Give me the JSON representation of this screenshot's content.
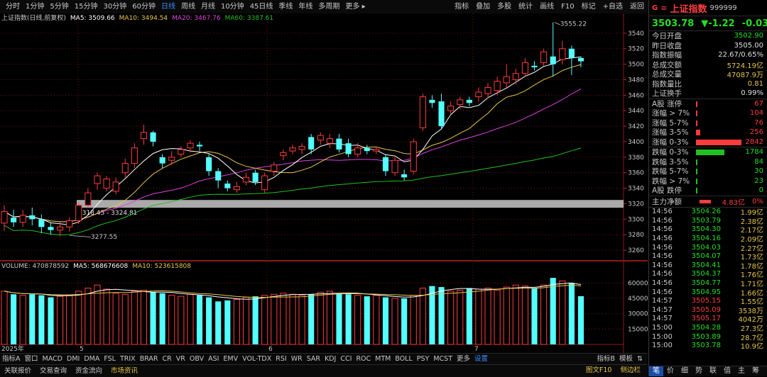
{
  "topbar": {
    "periods": [
      "分时",
      "1分钟",
      "5分钟",
      "15分钟",
      "30分钟",
      "60分钟",
      "日线",
      "周线",
      "月线",
      "10分钟",
      "45日线",
      "季线",
      "年线",
      "多周期",
      "更多 ▸"
    ],
    "active_index": 6,
    "tools": [
      "指标",
      "叠加",
      "多股",
      "统计",
      "画线",
      "F10",
      "标记",
      "+自选",
      "返回"
    ]
  },
  "legend": {
    "title": "上证指数(日线,前复权)",
    "ma5": "MA5: 3509.66",
    "ma10": "MA10: 3494.54",
    "ma20": "MA20: 3467.76",
    "ma60": "MA60: 3387.61"
  },
  "annotations": {
    "high": "3555.22",
    "low": "3277.55",
    "range_box": "3318.45 - 3324.81"
  },
  "volume_legend": {
    "volume": "VOLUME: 470878592",
    "ma5": "MA5: 568676608",
    "ma10": "MA10: 523615808"
  },
  "colors": {
    "up": "#ff3c3c",
    "down": "#54ffff",
    "ma5": "#ffffff",
    "ma10": "#e6c64a",
    "ma20": "#e040e0",
    "ma60": "#20c020",
    "grid": "#8b1a1a"
  },
  "chart_data": {
    "type": "candlestick",
    "price_axis": {
      "ticks": [
        3260,
        3280,
        3300,
        3320,
        3340,
        3360,
        3380,
        3400,
        3420,
        3440,
        3460,
        3480,
        3500,
        3520,
        3540
      ],
      "range": [
        3250,
        3560
      ]
    },
    "volume_axis": {
      "ticks": [
        "60000",
        "45000",
        "30000",
        "15000"
      ],
      "range": [
        0,
        72000
      ]
    },
    "x_labels": [
      "2025年",
      "5",
      "6",
      "7"
    ],
    "candles": [
      [
        3295,
        3310,
        3285,
        3318
      ],
      [
        3302,
        3296,
        3290,
        3312
      ],
      [
        3296,
        3305,
        3290,
        3312
      ],
      [
        3305,
        3300,
        3292,
        3315
      ],
      [
        3300,
        3290,
        3282,
        3306
      ],
      [
        3290,
        3286,
        3280,
        3296
      ],
      [
        3286,
        3290,
        3278,
        3296
      ],
      [
        3290,
        3298,
        3284,
        3302
      ],
      [
        3298,
        3318,
        3294,
        3322
      ],
      [
        3318,
        3334,
        3314,
        3340
      ],
      [
        3346,
        3356,
        3338,
        3360
      ],
      [
        3340,
        3352,
        3336,
        3356
      ],
      [
        3336,
        3348,
        3332,
        3354
      ],
      [
        3360,
        3372,
        3354,
        3378
      ],
      [
        3372,
        3392,
        3366,
        3398
      ],
      [
        3404,
        3412,
        3396,
        3422
      ],
      [
        3412,
        3400,
        3394,
        3414
      ],
      [
        3380,
        3372,
        3366,
        3384
      ],
      [
        3376,
        3380,
        3370,
        3388
      ],
      [
        3384,
        3390,
        3380,
        3394
      ],
      [
        3392,
        3398,
        3386,
        3402
      ],
      [
        3396,
        3394,
        3388,
        3400
      ],
      [
        3380,
        3362,
        3356,
        3384
      ],
      [
        3362,
        3350,
        3340,
        3366
      ],
      [
        3346,
        3340,
        3336,
        3350
      ],
      [
        3338,
        3342,
        3334,
        3348
      ],
      [
        3348,
        3354,
        3344,
        3360
      ],
      [
        3360,
        3348,
        3344,
        3364
      ],
      [
        3338,
        3356,
        3334,
        3360
      ],
      [
        3362,
        3370,
        3356,
        3374
      ],
      [
        3382,
        3386,
        3376,
        3390
      ],
      [
        3388,
        3392,
        3384,
        3396
      ],
      [
        3390,
        3394,
        3384,
        3398
      ],
      [
        3406,
        3390,
        3384,
        3410
      ],
      [
        3402,
        3408,
        3396,
        3412
      ],
      [
        3398,
        3404,
        3392,
        3410
      ],
      [
        3404,
        3390,
        3386,
        3410
      ],
      [
        3398,
        3384,
        3380,
        3404
      ],
      [
        3384,
        3392,
        3380,
        3398
      ],
      [
        3392,
        3388,
        3384,
        3396
      ],
      [
        3388,
        3390,
        3384,
        3394
      ],
      [
        3380,
        3362,
        3356,
        3384
      ],
      [
        3360,
        3376,
        3356,
        3380
      ],
      [
        3358,
        3354,
        3350,
        3364
      ],
      [
        3362,
        3400,
        3358,
        3404
      ],
      [
        3418,
        3458,
        3414,
        3462
      ],
      [
        3454,
        3450,
        3444,
        3460
      ],
      [
        3452,
        3420,
        3416,
        3462
      ],
      [
        3440,
        3446,
        3436,
        3452
      ],
      [
        3448,
        3454,
        3442,
        3458
      ],
      [
        3454,
        3450,
        3446,
        3458
      ],
      [
        3458,
        3464,
        3452,
        3470
      ],
      [
        3462,
        3470,
        3456,
        3476
      ],
      [
        3466,
        3478,
        3460,
        3484
      ],
      [
        3476,
        3484,
        3470,
        3500
      ],
      [
        3480,
        3488,
        3474,
        3494
      ],
      [
        3488,
        3502,
        3484,
        3508
      ],
      [
        3498,
        3496,
        3492,
        3504
      ],
      [
        3502,
        3516,
        3498,
        3520
      ],
      [
        3510,
        3500,
        3484,
        3554
      ],
      [
        3506,
        3520,
        3500,
        3530
      ],
      [
        3520,
        3508,
        3486,
        3524
      ],
      [
        3508,
        3503.78,
        3496,
        3510
      ]
    ],
    "volumes": [
      52000,
      49000,
      48000,
      49000,
      48000,
      46000,
      47000,
      48000,
      52000,
      55000,
      58000,
      54000,
      50000,
      49000,
      52000,
      53000,
      51000,
      50000,
      48000,
      47000,
      49000,
      48000,
      46000,
      42000,
      43000,
      44000,
      46000,
      47000,
      48000,
      49000,
      50000,
      49000,
      48000,
      49000,
      51000,
      52000,
      50000,
      49000,
      48000,
      47000,
      48000,
      46000,
      45000,
      45000,
      48000,
      55000,
      57000,
      56000,
      52000,
      53000,
      55000,
      54000,
      55000,
      53000,
      56000,
      58000,
      57000,
      55000,
      58000,
      65000,
      62000,
      60000,
      47087
    ]
  },
  "indicators": {
    "label": "指标A",
    "items": [
      "窗口",
      "MACD",
      "DMI",
      "DMA",
      "FSL",
      "TRIX",
      "BRAR",
      "CR",
      "VR",
      "OBV",
      "ASI",
      "EMV",
      "VOL-TDX",
      "RSI",
      "WR",
      "SAR",
      "KDJ",
      "CCI",
      "ROC",
      "MTM",
      "BOLL",
      "PSY",
      "MCST",
      "更多",
      "设置"
    ],
    "right": [
      "指标B",
      "模板",
      "⇅"
    ]
  },
  "footer": {
    "items": [
      "关联报价",
      "交易查询",
      "资金流向",
      "市场资讯"
    ],
    "active_index": 3,
    "right": [
      "图文F10",
      "侧边栏"
    ]
  },
  "panel": {
    "g": "G",
    "menu": "≡",
    "name": "上证指数",
    "code": "999999",
    "price": "3503.78",
    "change": "▼-1.22",
    "pct": "-0.03%",
    "stats": [
      {
        "label": "今日开盘",
        "value": "3502.90",
        "color": "green"
      },
      {
        "label": "昨日收盘",
        "value": "3505.00",
        "color": "white"
      },
      {
        "label": "指数振幅",
        "value": "22.67/0.65%",
        "color": "white"
      },
      {
        "label": "总成交额",
        "value": "5724.19亿",
        "color": "yellow"
      },
      {
        "label": "总成交量",
        "value": "47087.9万",
        "color": "yellow"
      },
      {
        "label": "指数量比",
        "value": "0.81",
        "color": "yellow"
      },
      {
        "label": "上证换手",
        "value": "0.99%",
        "color": "white"
      }
    ],
    "breadth_up": [
      {
        "label": "A股 涨停",
        "value": "67",
        "bar": 0.0
      },
      {
        "label": "涨幅 > 7%",
        "value": "104",
        "bar": 0.0
      },
      {
        "label": "涨幅 5-7%",
        "value": "76",
        "bar": 0.0
      },
      {
        "label": "涨幅 3-5%",
        "value": "256",
        "bar": 0.09
      },
      {
        "label": "涨幅 0-3%",
        "value": "2842",
        "bar": 1.0
      }
    ],
    "breadth_down": [
      {
        "label": "跌幅 0-3%",
        "value": "1784",
        "bar": 0.63
      },
      {
        "label": "跌幅 3-5%",
        "value": "84",
        "bar": 0.0
      },
      {
        "label": "跌幅 5-7%",
        "value": "30",
        "bar": 0.0
      },
      {
        "label": "跌幅 > 7%",
        "value": "23",
        "bar": 0.0
      },
      {
        "label": "A股 跌停",
        "value": "0",
        "bar": 0.0
      }
    ],
    "flow": {
      "label": "主力净额",
      "value": "4.83亿",
      "pct": "0%"
    },
    "ticks": [
      {
        "time": "14:56",
        "price": "3504.26",
        "vol": "1.99亿",
        "pc": "green",
        "vc": "yellow"
      },
      {
        "time": "14:56",
        "price": "3503.79",
        "vol": "2.38亿",
        "pc": "green",
        "vc": "yellow"
      },
      {
        "time": "14:56",
        "price": "3504.30",
        "vol": "2.17亿",
        "pc": "green",
        "vc": "yellow"
      },
      {
        "time": "14:56",
        "price": "3504.16",
        "vol": "2.09亿",
        "pc": "green",
        "vc": "yellow"
      },
      {
        "time": "14:56",
        "price": "3504.03",
        "vol": "2.27亿",
        "pc": "green",
        "vc": "yellow"
      },
      {
        "time": "14:56",
        "price": "3504.07",
        "vol": "1.73亿",
        "pc": "green",
        "vc": "yellow"
      },
      {
        "time": "14:56",
        "price": "3504.41",
        "vol": "1.78亿",
        "pc": "green",
        "vc": "yellow"
      },
      {
        "time": "14:56",
        "price": "3504.37",
        "vol": "1.76亿",
        "pc": "green",
        "vc": "yellow"
      },
      {
        "time": "14:56",
        "price": "3504.77",
        "vol": "1.71亿",
        "pc": "green",
        "vc": "yellow"
      },
      {
        "time": "14:56",
        "price": "3504.95",
        "vol": "1.66亿",
        "pc": "green",
        "vc": "yellow"
      },
      {
        "time": "14:57",
        "price": "3505.15",
        "vol": "1.55亿",
        "pc": "red",
        "vc": "yellow"
      },
      {
        "time": "14:57",
        "price": "3505.09",
        "vol": "3538万",
        "pc": "red",
        "vc": "yellow"
      },
      {
        "time": "14:57",
        "price": "3505.17",
        "vol": "4042万",
        "pc": "red",
        "vc": "yellow"
      },
      {
        "time": "15:00",
        "price": "3504.28",
        "vol": "27.3亿",
        "pc": "green",
        "vc": "yellow"
      },
      {
        "time": "15:00",
        "price": "3503.89",
        "vol": "28.7亿",
        "pc": "green",
        "vc": "yellow"
      },
      {
        "time": "15:00",
        "price": "3503.78",
        "vol": "10.9亿",
        "pc": "green",
        "vc": "yellow"
      }
    ],
    "foot": [
      "笔",
      "价",
      "细",
      "势",
      "联",
      "值",
      "主",
      "筹"
    ],
    "foot_active": 0
  }
}
